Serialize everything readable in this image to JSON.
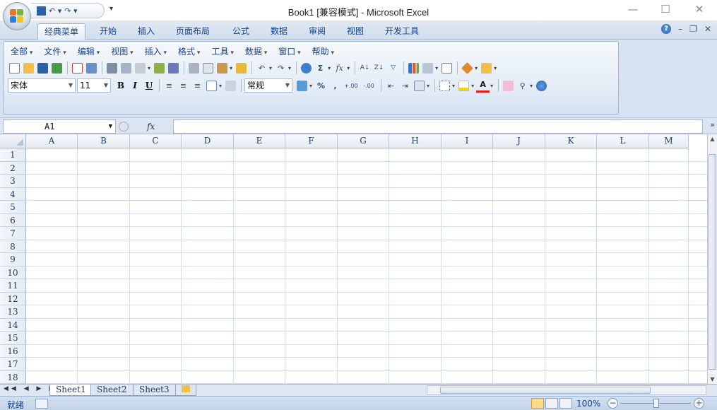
{
  "window": {
    "title": "Book1  [兼容模式] - Microsoft Excel",
    "minimize": "—",
    "maximize": "☐",
    "close": "✕"
  },
  "quick_access": {
    "save_icon": "save-icon",
    "undo": "↶ ▾",
    "redo": "↷ ▾",
    "more": "▾"
  },
  "tabs": [
    {
      "label": "经典菜单",
      "active": true
    },
    {
      "label": "开始"
    },
    {
      "label": "插入"
    },
    {
      "label": "页面布局"
    },
    {
      "label": "公式"
    },
    {
      "label": "数据"
    },
    {
      "label": "审阅"
    },
    {
      "label": "视图"
    },
    {
      "label": "开发工具"
    }
  ],
  "ribbon_right": {
    "help": "?",
    "min": "–",
    "restore": "❐",
    "close": "✕"
  },
  "menus": [
    "全部",
    "文件",
    "编辑",
    "视图",
    "插入",
    "格式",
    "工具",
    "数据",
    "窗口",
    "帮助"
  ],
  "format_bar": {
    "font": "宋体",
    "size": "11",
    "bold": "B",
    "italic": "I",
    "underline": "U",
    "number_format": "常规",
    "percent": "%",
    "comma": ",",
    "increase_decimal": ".0→.00",
    "decrease_decimal": ".00→.0"
  },
  "formula_bar": {
    "name_box": "A1",
    "name_arrow": "▼",
    "cancel": "ⓧ",
    "fx": "fx",
    "expand": "»"
  },
  "columns": [
    "A",
    "B",
    "C",
    "D",
    "E",
    "F",
    "G",
    "H",
    "I",
    "J",
    "K",
    "L",
    "M"
  ],
  "rows": [
    "1",
    "2",
    "3",
    "4",
    "5",
    "6",
    "7",
    "8",
    "9",
    "10",
    "11",
    "12",
    "13",
    "14",
    "15",
    "16",
    "17",
    "18"
  ],
  "sheets": [
    {
      "label": "Sheet1",
      "active": true
    },
    {
      "label": "Sheet2"
    },
    {
      "label": "Sheet3"
    }
  ],
  "sheet_nav": "◀◀ ◀ ▶ ▶▶",
  "status": {
    "text": "就绪",
    "zoom": "100%",
    "zoom_minus": "−",
    "zoom_plus": "+"
  },
  "colors": {
    "accent": "#15428b",
    "ribbon_bg": "#d7e3f2",
    "grid_line": "#d4dde9"
  }
}
